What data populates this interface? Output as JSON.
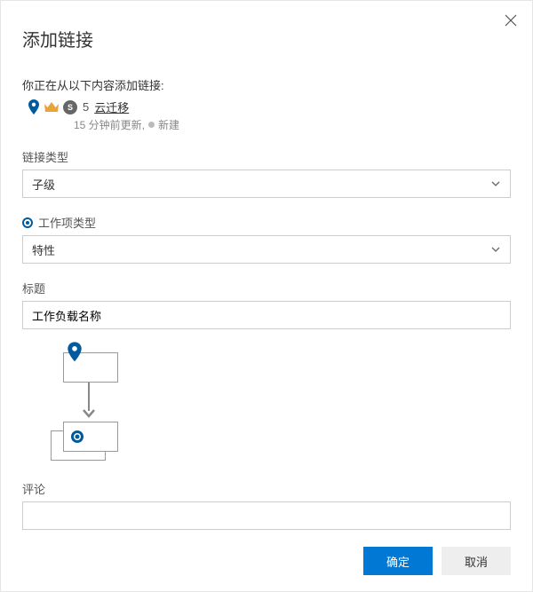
{
  "dialog": {
    "title": "添加链接",
    "subtitle": "你正在从以下内容添加链接:",
    "item": {
      "id": "5",
      "name": "云迁移",
      "meta_time": "15 分钟前更新,",
      "status": "新建",
      "badge_letter": "S"
    }
  },
  "fields": {
    "link_type_label": "链接类型",
    "link_type_value": "子级",
    "work_item_type_label": "工作项类型",
    "work_item_type_value": "特性",
    "title_label": "标题",
    "title_value": "工作负载名称",
    "comment_label": "评论"
  },
  "buttons": {
    "ok": "确定",
    "cancel": "取消"
  }
}
